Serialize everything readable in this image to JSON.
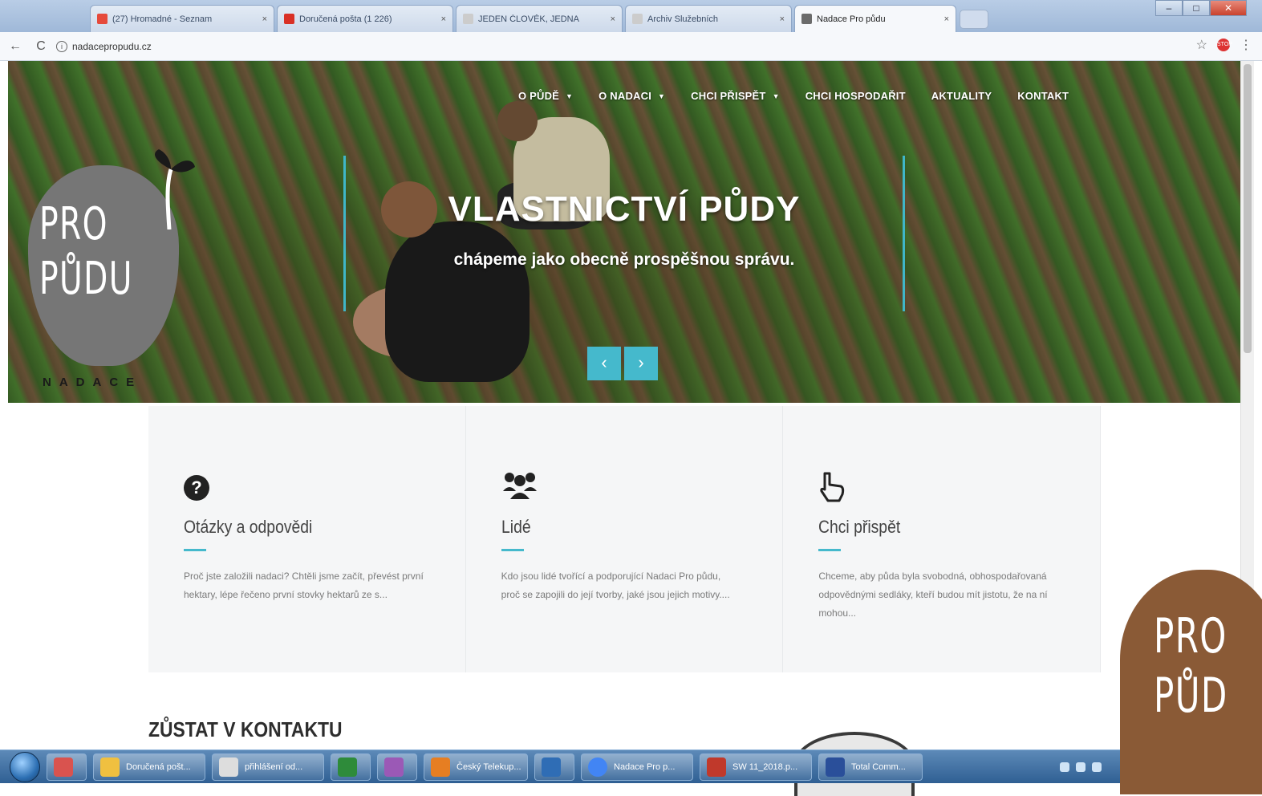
{
  "browser": {
    "tabs": [
      {
        "label": "(27) Hromadné - Seznam",
        "fav_color": "#e64a3b"
      },
      {
        "label": "Doručená pošta (1 226)",
        "fav_color": "#d93025"
      },
      {
        "label": "JEDEN ČLOVĚK, JEDNA",
        "fav_color": "#cccccc"
      },
      {
        "label": "Archiv Služebních",
        "fav_color": "#cccccc"
      },
      {
        "label": "Nadace Pro půdu",
        "fav_color": "#6b6b6b"
      }
    ],
    "tab_close": "×",
    "url": "nadacepropudu.cz",
    "back": "←",
    "reload": "C",
    "info": "i",
    "star": "☆",
    "menu": "⋮",
    "stop": "STOP",
    "win_min": "–",
    "win_max": "□",
    "win_close": "✕"
  },
  "site": {
    "nav": [
      {
        "label": "O PŮDĚ",
        "dropdown": true
      },
      {
        "label": "O NADACI",
        "dropdown": true
      },
      {
        "label": "CHCI PŘISPĚT",
        "dropdown": true
      },
      {
        "label": "CHCI HOSPODAŘIT",
        "dropdown": false
      },
      {
        "label": "AKTUALITY",
        "dropdown": false
      },
      {
        "label": "KONTAKT",
        "dropdown": false
      }
    ],
    "logo": {
      "line1": "PRO",
      "line2": "PŮDU",
      "sub": "NADACE"
    },
    "slide": {
      "title": "VLASTNICTVÍ PŮDY",
      "subtitle": "chápeme jako obecně prospěšnou správu.",
      "prev": "‹",
      "next": "›"
    },
    "cards": [
      {
        "icon": "question-circle-icon",
        "title": "Otázky a odpovědi",
        "text": "Proč jste založili nadaci? Chtěli jsme začít, převést první hektary, lépe řečeno první stovky hektarů ze s..."
      },
      {
        "icon": "people-group-icon",
        "title": "Lidé",
        "text": "Kdo jsou lidé tvořící a podporující Nadaci Pro půdu, proč se zapojili do její tvorby, jaké jsou jejich motivy...."
      },
      {
        "icon": "hand-pointer-icon",
        "title": "Chci přispět",
        "text": "Chceme, aby půda byla svobodná, obhospodařovaná odpovědnými sedláky, kteří budou mít jistotu, že na ní mohou..."
      }
    ],
    "contact_heading": "ZŮSTAT V KONTAKTU",
    "corner_logo": {
      "line1": "PRO",
      "line2": "PŮD"
    }
  },
  "taskbar": {
    "items": [
      {
        "label": "",
        "color": "#d9534f"
      },
      {
        "label": "Doručená pošt...",
        "color": "#f0c040"
      },
      {
        "label": "přihlášení od...",
        "color": "#dddddd"
      },
      {
        "label": "",
        "color": "#2e8b3a"
      },
      {
        "label": "",
        "color": "#9b59b6"
      },
      {
        "label": "Český Telekup...",
        "color": "#e67e22"
      },
      {
        "label": "",
        "color": "#2f6db5"
      },
      {
        "label": "Nadace Pro p...",
        "color": "#4285f4"
      },
      {
        "label": "SW 11_2018.p...",
        "color": "#c0392b"
      },
      {
        "label": "Total Comm...",
        "color": "#2a4f9a"
      }
    ]
  }
}
